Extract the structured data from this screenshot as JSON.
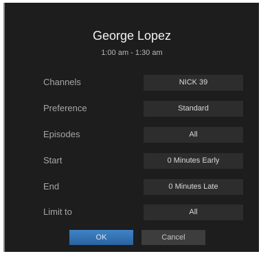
{
  "dialog": {
    "title": "George Lopez",
    "time": "1:00 am - 1:30 am"
  },
  "rows": [
    {
      "label": "Channels",
      "value": "NICK 39"
    },
    {
      "label": "Preference",
      "value": "Standard"
    },
    {
      "label": "Episodes",
      "value": "All"
    },
    {
      "label": "Start",
      "value": "0 Minutes Early"
    },
    {
      "label": "End",
      "value": "0 Minutes Late"
    },
    {
      "label": "Limit to",
      "value": "All"
    }
  ],
  "buttons": {
    "ok": "OK",
    "cancel": "Cancel"
  },
  "colors": {
    "dialog_background": "#1d1d1d",
    "field_background": "#2d2d2d",
    "ok_button": "#3a78b8",
    "cancel_button": "#3d3d3d"
  }
}
